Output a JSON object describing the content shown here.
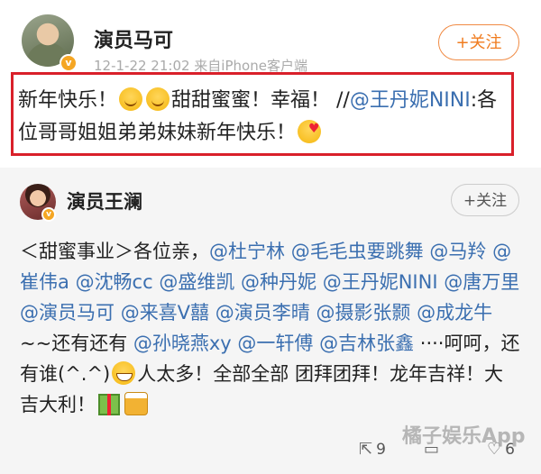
{
  "post": {
    "author": "演员马可",
    "meta": "12-1-22 21:02  来自iPhone客户端",
    "follow_label": "+关注",
    "text_before": "新年快乐！",
    "text_mid": "甜甜蜜蜜！幸福！ //",
    "mention": "@王丹妮NINI",
    "text_after": ":各位哥哥姐姐弟弟妹妹新年快乐！"
  },
  "repost": {
    "author": "演员王澜",
    "follow_label": "+关注",
    "segments": [
      {
        "t": "＜甜蜜事业＞各位亲，",
        "m": false
      },
      {
        "t": "@杜宁林",
        "m": true
      },
      {
        "t": " ",
        "m": false
      },
      {
        "t": "@毛毛虫要跳舞",
        "m": true
      },
      {
        "t": " ",
        "m": false
      },
      {
        "t": "@马羚",
        "m": true
      },
      {
        "t": " ",
        "m": false
      },
      {
        "t": "@崔伟a",
        "m": true
      },
      {
        "t": " ",
        "m": false
      },
      {
        "t": "@沈畅cc",
        "m": true
      },
      {
        "t": " ",
        "m": false
      },
      {
        "t": "@盛维凯",
        "m": true
      },
      {
        "t": " ",
        "m": false
      },
      {
        "t": "@种丹妮",
        "m": true
      },
      {
        "t": " ",
        "m": false
      },
      {
        "t": "@王丹妮NINI",
        "m": true
      },
      {
        "t": " ",
        "m": false
      },
      {
        "t": "@唐万里",
        "m": true
      },
      {
        "t": " ",
        "m": false
      },
      {
        "t": "@演员马可",
        "m": true
      },
      {
        "t": " ",
        "m": false
      },
      {
        "t": "@来喜V囍",
        "m": true
      },
      {
        "t": " ",
        "m": false
      },
      {
        "t": "@演员李晴",
        "m": true
      },
      {
        "t": " ",
        "m": false
      },
      {
        "t": "@摄影张颢",
        "m": true
      },
      {
        "t": " ",
        "m": false
      },
      {
        "t": "@成龙牛",
        "m": true
      },
      {
        "t": " ~~还有还有 ",
        "m": false
      },
      {
        "t": "@孙晓燕xy",
        "m": true
      },
      {
        "t": " ",
        "m": false
      },
      {
        "t": "@一轩傅",
        "m": true
      },
      {
        "t": " ",
        "m": false
      },
      {
        "t": "@吉林张鑫",
        "m": true
      },
      {
        "t": " ····呵呵，还有谁(^.^)",
        "m": false
      }
    ],
    "tail1": "人太多！全部全部 团拜团拜！龙年吉祥！大吉大利！"
  },
  "footer": {
    "repost_count": "9",
    "comment_count": "",
    "like_count": "6"
  },
  "watermark": "橘子娱乐App",
  "colors": {
    "accent": "#f07c1f",
    "mention": "#3b6fb0",
    "highlight_border": "#d9202a"
  },
  "icons": [
    "verified-badge-icon",
    "smile-emoji-icon",
    "kiss-emoji-icon",
    "grin-emoji-icon",
    "gift-emoji-icon",
    "beer-emoji-icon",
    "repost-icon",
    "comment-icon",
    "like-icon"
  ]
}
